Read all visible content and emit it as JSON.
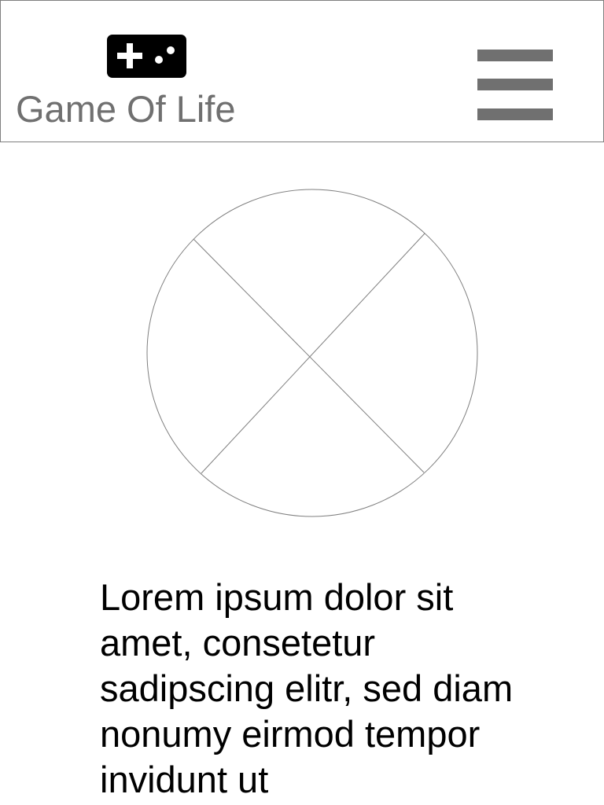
{
  "header": {
    "title": "Game Of Life",
    "logo_icon": "gamepad-icon",
    "menu_icon": "hamburger-menu-icon"
  },
  "hero": {
    "image_placeholder_icon": "image-placeholder-icon"
  },
  "content": {
    "paragraph": "Lorem ipsum dolor sit amet, consetetur sadipscing elitr, sed diam nonumy eirmod tempor invidunt ut"
  },
  "colors": {
    "header_border": "#7f7f7f",
    "title_text": "#707070",
    "menu_bars": "#707070",
    "logo": "#000000",
    "body_text": "#000000"
  }
}
